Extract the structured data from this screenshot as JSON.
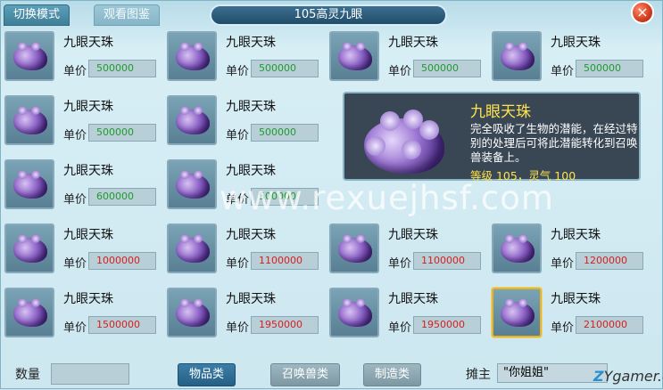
{
  "tabs": {
    "switch_mode": "切换模式",
    "view_catalog": "观看图鉴"
  },
  "title": "105高灵九眼",
  "close_icon": "×",
  "item_name": "九眼天珠",
  "price_label": "单价",
  "items": [
    {
      "price": "500000"
    },
    {
      "price": "500000"
    },
    {
      "price": "500000"
    },
    {
      "price": "500000"
    },
    {
      "price": "500000"
    },
    {
      "price": "500000"
    },
    {
      "price": "600000"
    },
    {
      "price": "500000"
    },
    {
      "price": "1000000"
    },
    {
      "price": "1100000"
    },
    {
      "price": "1100000"
    },
    {
      "price": "1200000"
    },
    {
      "price": "1500000"
    },
    {
      "price": "1950000"
    },
    {
      "price": "1950000"
    },
    {
      "price": "2100000"
    }
  ],
  "tooltip": {
    "title": "九眼天珠",
    "description": "完全吸收了生物的潜能，在经过特别的处理后可将此潜能转化到召唤兽装备上。",
    "stats": "等级 105，灵气 100"
  },
  "watermark": "www.rexuejhsf.com",
  "bottom": {
    "qty_label": "数量",
    "btn_items": "物品类",
    "btn_summon": "召唤兽类",
    "btn_craft": "制造类",
    "seller_label": "摊主",
    "seller_name": "\"你姐姐\"",
    "logo_z": "Z",
    "logo_rest": "Ygamer.com"
  },
  "colors": {
    "price_green": "#1f9a2e",
    "price_red": "#d21f1f",
    "tooltip_gold": "#ffe34a"
  }
}
